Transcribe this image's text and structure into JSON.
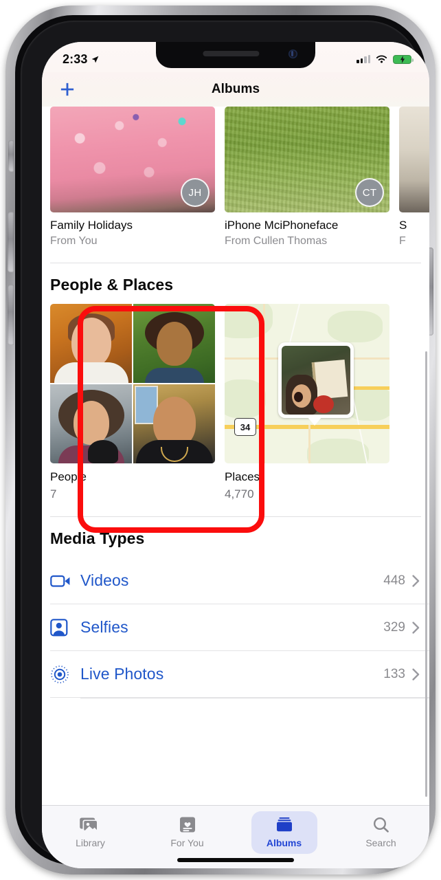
{
  "status_bar": {
    "time": "2:33",
    "location_icon": "location-arrow-icon",
    "cellular_icon": "cellular-signal-icon",
    "cellular_bars_filled": 2,
    "wifi_icon": "wifi-icon",
    "battery_icon": "battery-charging-icon",
    "battery_color": "#3dbb54"
  },
  "nav": {
    "add_label": "+",
    "title": "Albums"
  },
  "shared_albums": [
    {
      "title": "Family Holidays",
      "subtitle": "From You",
      "avatar": "JH",
      "thumb": "cake"
    },
    {
      "title": "iPhone MciPhoneface",
      "subtitle": "From Cullen Thomas",
      "avatar": "CT",
      "thumb": "grass"
    },
    {
      "title": "S",
      "subtitle": "F",
      "avatar": "",
      "thumb": "tan"
    }
  ],
  "people_places": {
    "section_title": "People & Places",
    "people": {
      "label": "People",
      "count": "7"
    },
    "places": {
      "label": "Places",
      "count": "4,770",
      "highway_shield": "34"
    }
  },
  "media_types": {
    "section_title": "Media Types",
    "rows": [
      {
        "label": "Videos",
        "count": "448",
        "icon": "video-camera-icon"
      },
      {
        "label": "Selfies",
        "count": "329",
        "icon": "selfie-person-icon"
      },
      {
        "label": "Live Photos",
        "count": "133",
        "icon": "live-photo-icon"
      }
    ]
  },
  "tab_bar": {
    "tabs": [
      {
        "label": "Library",
        "icon": "photo-stack-icon",
        "active": false
      },
      {
        "label": "For You",
        "icon": "for-you-card-icon",
        "active": false
      },
      {
        "label": "Albums",
        "icon": "albums-folder-icon",
        "active": true
      },
      {
        "label": "Search",
        "icon": "search-magnifier-icon",
        "active": false
      }
    ]
  },
  "annotation": {
    "color": "#fb0d0d",
    "target": "people-card"
  }
}
